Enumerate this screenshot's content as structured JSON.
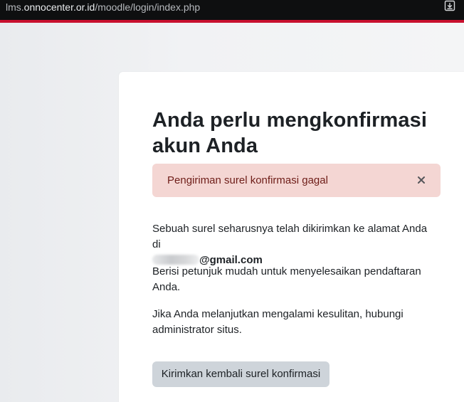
{
  "browser": {
    "url_prefix": "lms.",
    "url_host": "onnocenter.or.id",
    "url_path": "/moodle/login/index.php",
    "download_icon": "download-icon"
  },
  "colors": {
    "brand_red": "#c8102e",
    "alert_bg": "#f4d6d3",
    "alert_text": "#6e1d18",
    "button_bg": "#ced4da"
  },
  "page": {
    "title": "Anda perlu mengkonfirmasi akun Anda",
    "alert": {
      "message": "Pengiriman surel konfirmasi gagal",
      "close_icon": "close-icon"
    },
    "paragraph1": {
      "text": "Sebuah surel seharusnya telah dikirimkan ke alamat Anda di",
      "email_suffix": "@gmail.com"
    },
    "paragraph2": "Berisi petunjuk mudah untuk menyelesaikan pendaftaran Anda.",
    "paragraph3": "Jika Anda melanjutkan mengalami kesulitan, hubungi administrator situs.",
    "resend_button": "Kirimkan kembali surel konfirmasi"
  }
}
